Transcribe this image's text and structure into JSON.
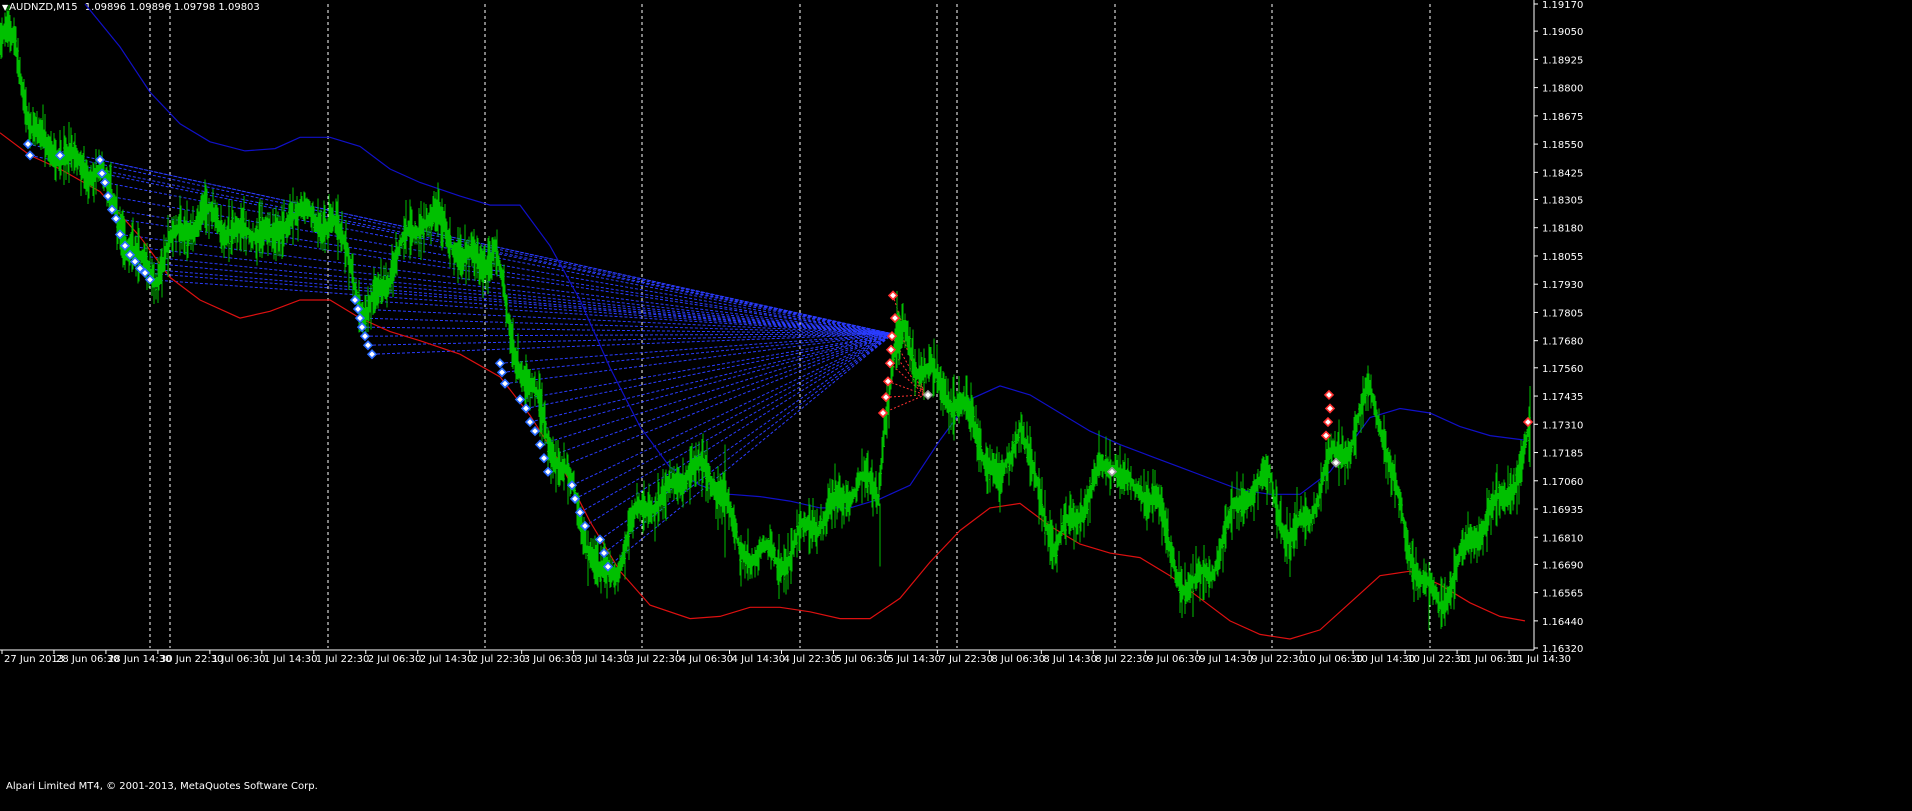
{
  "window": {
    "symbol_timeframe": "AUDNZD,M15",
    "ohlc": [
      "1.09896",
      "1.09896",
      "1.09798",
      "1.09803"
    ],
    "dropdown_glyph": "▼"
  },
  "footer": {
    "copyright": "Alpari Limited MT4, © 2001-2013, MetaQuotes Software Corp."
  },
  "colors": {
    "background": "#000000",
    "bars": "#00c000",
    "upper_band": "#1010c8",
    "lower_band": "#dd1010",
    "projection_lines": "#2a3cff",
    "buy_marker": "#2a6cff",
    "sell_marker": "#ff3030",
    "axis": "#ffffff",
    "separators": "#ffffff"
  },
  "chart_data": {
    "type": "candlestick",
    "y_axis_labels": [
      "1.19170",
      "1.19050",
      "1.18925",
      "1.18800",
      "1.18675",
      "1.18550",
      "1.18425",
      "1.18305",
      "1.18180",
      "1.18055",
      "1.17930",
      "1.17805",
      "1.17680",
      "1.17560",
      "1.17435",
      "1.17310",
      "1.17185",
      "1.17060",
      "1.16935",
      "1.16810",
      "1.16690",
      "1.16565",
      "1.16440",
      "1.16320"
    ],
    "x_axis_labels": [
      "27 Jun 2013",
      "28 Jun 06:30",
      "28 Jun 14:30",
      "30 Jun 22:30",
      "1 Jul 06:30",
      "1 Jul 14:30",
      "1 Jul 22:30",
      "2 Jul 06:30",
      "2 Jul 14:30",
      "2 Jul 22:30",
      "3 Jul 06:30",
      "3 Jul 14:30",
      "3 Jul 22:30",
      "4 Jul 06:30",
      "4 Jul 14:30",
      "4 Jul 22:30",
      "5 Jul 06:30",
      "5 Jul 14:30",
      "7 Jul 22:30",
      "8 Jul 06:30",
      "8 Jul 14:30",
      "8 Jul 22:30",
      "9 Jul 06:30",
      "9 Jul 14:30",
      "9 Jul 22:30",
      "10 Jul 06:30",
      "10 Jul 14:30",
      "10 Jul 22:30",
      "11 Jul 06:30",
      "11 Jul 14:30"
    ],
    "ylim": [
      1.1632,
      1.1917
    ],
    "x_index_range": [
      0,
      1530
    ],
    "price_series": [
      [
        0,
        1.1903
      ],
      [
        15,
        1.1897
      ],
      [
        30,
        1.186
      ],
      [
        45,
        1.1848
      ],
      [
        60,
        1.1852
      ],
      [
        80,
        1.1846
      ],
      [
        100,
        1.1848
      ],
      [
        120,
        1.1822
      ],
      [
        140,
        1.18
      ],
      [
        155,
        1.1794
      ],
      [
        170,
        1.1806
      ],
      [
        190,
        1.1818
      ],
      [
        215,
        1.1826
      ],
      [
        240,
        1.1818
      ],
      [
        260,
        1.1822
      ],
      [
        275,
        1.1808
      ],
      [
        290,
        1.1824
      ],
      [
        305,
        1.1818
      ],
      [
        330,
        1.182
      ],
      [
        350,
        1.1808
      ],
      [
        365,
        1.178
      ],
      [
        380,
        1.1794
      ],
      [
        400,
        1.1808
      ],
      [
        425,
        1.182
      ],
      [
        445,
        1.1814
      ],
      [
        465,
        1.1804
      ],
      [
        480,
        1.1804
      ],
      [
        495,
        1.1814
      ],
      [
        502,
        1.1796
      ],
      [
        510,
        1.1772
      ],
      [
        530,
        1.175
      ],
      [
        550,
        1.172
      ],
      [
        570,
        1.17
      ],
      [
        585,
        1.168
      ],
      [
        600,
        1.1662
      ],
      [
        615,
        1.1668
      ],
      [
        630,
        1.169
      ],
      [
        650,
        1.17
      ],
      [
        670,
        1.17
      ],
      [
        690,
        1.171
      ],
      [
        710,
        1.1702
      ],
      [
        725,
        1.17
      ],
      [
        740,
        1.1672
      ],
      [
        760,
        1.168
      ],
      [
        780,
        1.1672
      ],
      [
        800,
        1.1682
      ],
      [
        820,
        1.1686
      ],
      [
        840,
        1.1692
      ],
      [
        860,
        1.1706
      ],
      [
        878,
        1.17
      ],
      [
        885,
        1.1738
      ],
      [
        895,
        1.1768
      ],
      [
        905,
        1.1774
      ],
      [
        915,
        1.1762
      ],
      [
        928,
        1.1756
      ],
      [
        940,
        1.1746
      ],
      [
        960,
        1.1736
      ],
      [
        980,
        1.172
      ],
      [
        1000,
        1.1702
      ],
      [
        1020,
        1.1736
      ],
      [
        1035,
        1.1708
      ],
      [
        1055,
        1.168
      ],
      [
        1075,
        1.1688
      ],
      [
        1095,
        1.1702
      ],
      [
        1115,
        1.1712
      ],
      [
        1135,
        1.1698
      ],
      [
        1155,
        1.1706
      ],
      [
        1170,
        1.1676
      ],
      [
        1190,
        1.166
      ],
      [
        1210,
        1.1664
      ],
      [
        1230,
        1.1684
      ],
      [
        1250,
        1.17
      ],
      [
        1270,
        1.1706
      ],
      [
        1290,
        1.1682
      ],
      [
        1310,
        1.1696
      ],
      [
        1330,
        1.1716
      ],
      [
        1350,
        1.172
      ],
      [
        1370,
        1.1742
      ],
      [
        1380,
        1.173
      ],
      [
        1395,
        1.17
      ],
      [
        1410,
        1.1676
      ],
      [
        1425,
        1.1662
      ],
      [
        1440,
        1.1656
      ],
      [
        1460,
        1.1672
      ],
      [
        1480,
        1.1684
      ],
      [
        1500,
        1.1692
      ],
      [
        1515,
        1.1704
      ],
      [
        1530,
        1.1724
      ]
    ],
    "upper_band": [
      [
        85,
        1.1917
      ],
      [
        120,
        1.1898
      ],
      [
        150,
        1.1878
      ],
      [
        180,
        1.1864
      ],
      [
        210,
        1.1856
      ],
      [
        245,
        1.1852
      ],
      [
        275,
        1.1853
      ],
      [
        300,
        1.1858
      ],
      [
        330,
        1.1858
      ],
      [
        360,
        1.1854
      ],
      [
        390,
        1.1844
      ],
      [
        420,
        1.1838
      ],
      [
        460,
        1.1832
      ],
      [
        490,
        1.1828
      ],
      [
        520,
        1.1828
      ],
      [
        550,
        1.181
      ],
      [
        580,
        1.1786
      ],
      [
        610,
        1.1756
      ],
      [
        640,
        1.173
      ],
      [
        670,
        1.1712
      ],
      [
        700,
        1.1704
      ],
      [
        730,
        1.17
      ],
      [
        760,
        1.1699
      ],
      [
        790,
        1.1697
      ],
      [
        820,
        1.1694
      ],
      [
        850,
        1.1694
      ],
      [
        880,
        1.1698
      ],
      [
        910,
        1.1704
      ],
      [
        940,
        1.1724
      ],
      [
        970,
        1.1742
      ],
      [
        1000,
        1.1748
      ],
      [
        1030,
        1.1744
      ],
      [
        1060,
        1.1736
      ],
      [
        1090,
        1.1728
      ],
      [
        1120,
        1.1722
      ],
      [
        1150,
        1.1717
      ],
      [
        1180,
        1.1712
      ],
      [
        1210,
        1.1707
      ],
      [
        1240,
        1.1702
      ],
      [
        1270,
        1.17
      ],
      [
        1300,
        1.17
      ],
      [
        1330,
        1.171
      ],
      [
        1350,
        1.1722
      ],
      [
        1370,
        1.1734
      ],
      [
        1400,
        1.1738
      ],
      [
        1430,
        1.1736
      ],
      [
        1460,
        1.173
      ],
      [
        1490,
        1.1726
      ],
      [
        1525,
        1.1724
      ]
    ],
    "lower_band": [
      [
        0,
        1.186
      ],
      [
        30,
        1.185
      ],
      [
        60,
        1.1844
      ],
      [
        100,
        1.1834
      ],
      [
        140,
        1.1814
      ],
      [
        170,
        1.1796
      ],
      [
        200,
        1.1786
      ],
      [
        240,
        1.1778
      ],
      [
        270,
        1.1781
      ],
      [
        300,
        1.1786
      ],
      [
        330,
        1.1786
      ],
      [
        360,
        1.1778
      ],
      [
        390,
        1.1772
      ],
      [
        420,
        1.1768
      ],
      [
        460,
        1.1762
      ],
      [
        500,
        1.1752
      ],
      [
        530,
        1.1735
      ],
      [
        560,
        1.1714
      ],
      [
        590,
        1.1688
      ],
      [
        620,
        1.1666
      ],
      [
        650,
        1.1651
      ],
      [
        690,
        1.1645
      ],
      [
        720,
        1.1646
      ],
      [
        750,
        1.165
      ],
      [
        780,
        1.165
      ],
      [
        810,
        1.1648
      ],
      [
        840,
        1.1645
      ],
      [
        870,
        1.1645
      ],
      [
        900,
        1.1654
      ],
      [
        930,
        1.167
      ],
      [
        960,
        1.1684
      ],
      [
        990,
        1.1694
      ],
      [
        1020,
        1.1696
      ],
      [
        1050,
        1.1686
      ],
      [
        1080,
        1.1678
      ],
      [
        1110,
        1.1674
      ],
      [
        1140,
        1.1672
      ],
      [
        1170,
        1.1664
      ],
      [
        1200,
        1.1654
      ],
      [
        1230,
        1.1644
      ],
      [
        1260,
        1.1638
      ],
      [
        1290,
        1.1636
      ],
      [
        1320,
        1.164
      ],
      [
        1350,
        1.1652
      ],
      [
        1380,
        1.1664
      ],
      [
        1410,
        1.1666
      ],
      [
        1440,
        1.166
      ],
      [
        1470,
        1.1652
      ],
      [
        1500,
        1.1646
      ],
      [
        1525,
        1.1644
      ]
    ],
    "projection_pivot": [
      893,
      1.1771
    ],
    "projection_sources": [
      [
        28,
        1.1855
      ],
      [
        30,
        1.185
      ],
      [
        60,
        1.185
      ],
      [
        100,
        1.1848
      ],
      [
        102,
        1.1842
      ],
      [
        105,
        1.1838
      ],
      [
        108,
        1.1832
      ],
      [
        112,
        1.1826
      ],
      [
        116,
        1.1822
      ],
      [
        120,
        1.1815
      ],
      [
        125,
        1.181
      ],
      [
        130,
        1.1806
      ],
      [
        135,
        1.1803
      ],
      [
        140,
        1.18
      ],
      [
        145,
        1.1798
      ],
      [
        150,
        1.1795
      ],
      [
        355,
        1.1786
      ],
      [
        358,
        1.1782
      ],
      [
        360,
        1.1778
      ],
      [
        362,
        1.1774
      ],
      [
        365,
        1.177
      ],
      [
        368,
        1.1766
      ],
      [
        372,
        1.1762
      ],
      [
        500,
        1.1758
      ],
      [
        502,
        1.1754
      ],
      [
        505,
        1.1749
      ],
      [
        520,
        1.1742
      ],
      [
        526,
        1.1738
      ],
      [
        530,
        1.1732
      ],
      [
        535,
        1.1728
      ],
      [
        540,
        1.1722
      ],
      [
        544,
        1.1716
      ],
      [
        548,
        1.171
      ],
      [
        572,
        1.1704
      ],
      [
        575,
        1.1698
      ],
      [
        580,
        1.1692
      ],
      [
        585,
        1.1686
      ],
      [
        600,
        1.168
      ],
      [
        604,
        1.1674
      ],
      [
        608,
        1.1668
      ]
    ],
    "sell_markers": [
      [
        893,
        1.1788
      ],
      [
        895,
        1.1778
      ],
      [
        892,
        1.177
      ],
      [
        891,
        1.1764
      ],
      [
        890,
        1.1758
      ],
      [
        888,
        1.175
      ],
      [
        886,
        1.1743
      ],
      [
        883,
        1.1736
      ],
      [
        1329,
        1.1744
      ],
      [
        1330,
        1.1738
      ],
      [
        1328,
        1.1732
      ],
      [
        1326,
        1.1726
      ],
      [
        1528,
        1.1732
      ]
    ],
    "red_projection_target": [
      925,
      1.1744
    ],
    "gray_markers": [
      [
        928,
        1.1744
      ],
      [
        1112,
        1.171
      ],
      [
        1336,
        1.1714
      ]
    ],
    "separator_indices": [
      150,
      170,
      328,
      485,
      642,
      800,
      937,
      957,
      1115,
      1272,
      1430
    ]
  }
}
